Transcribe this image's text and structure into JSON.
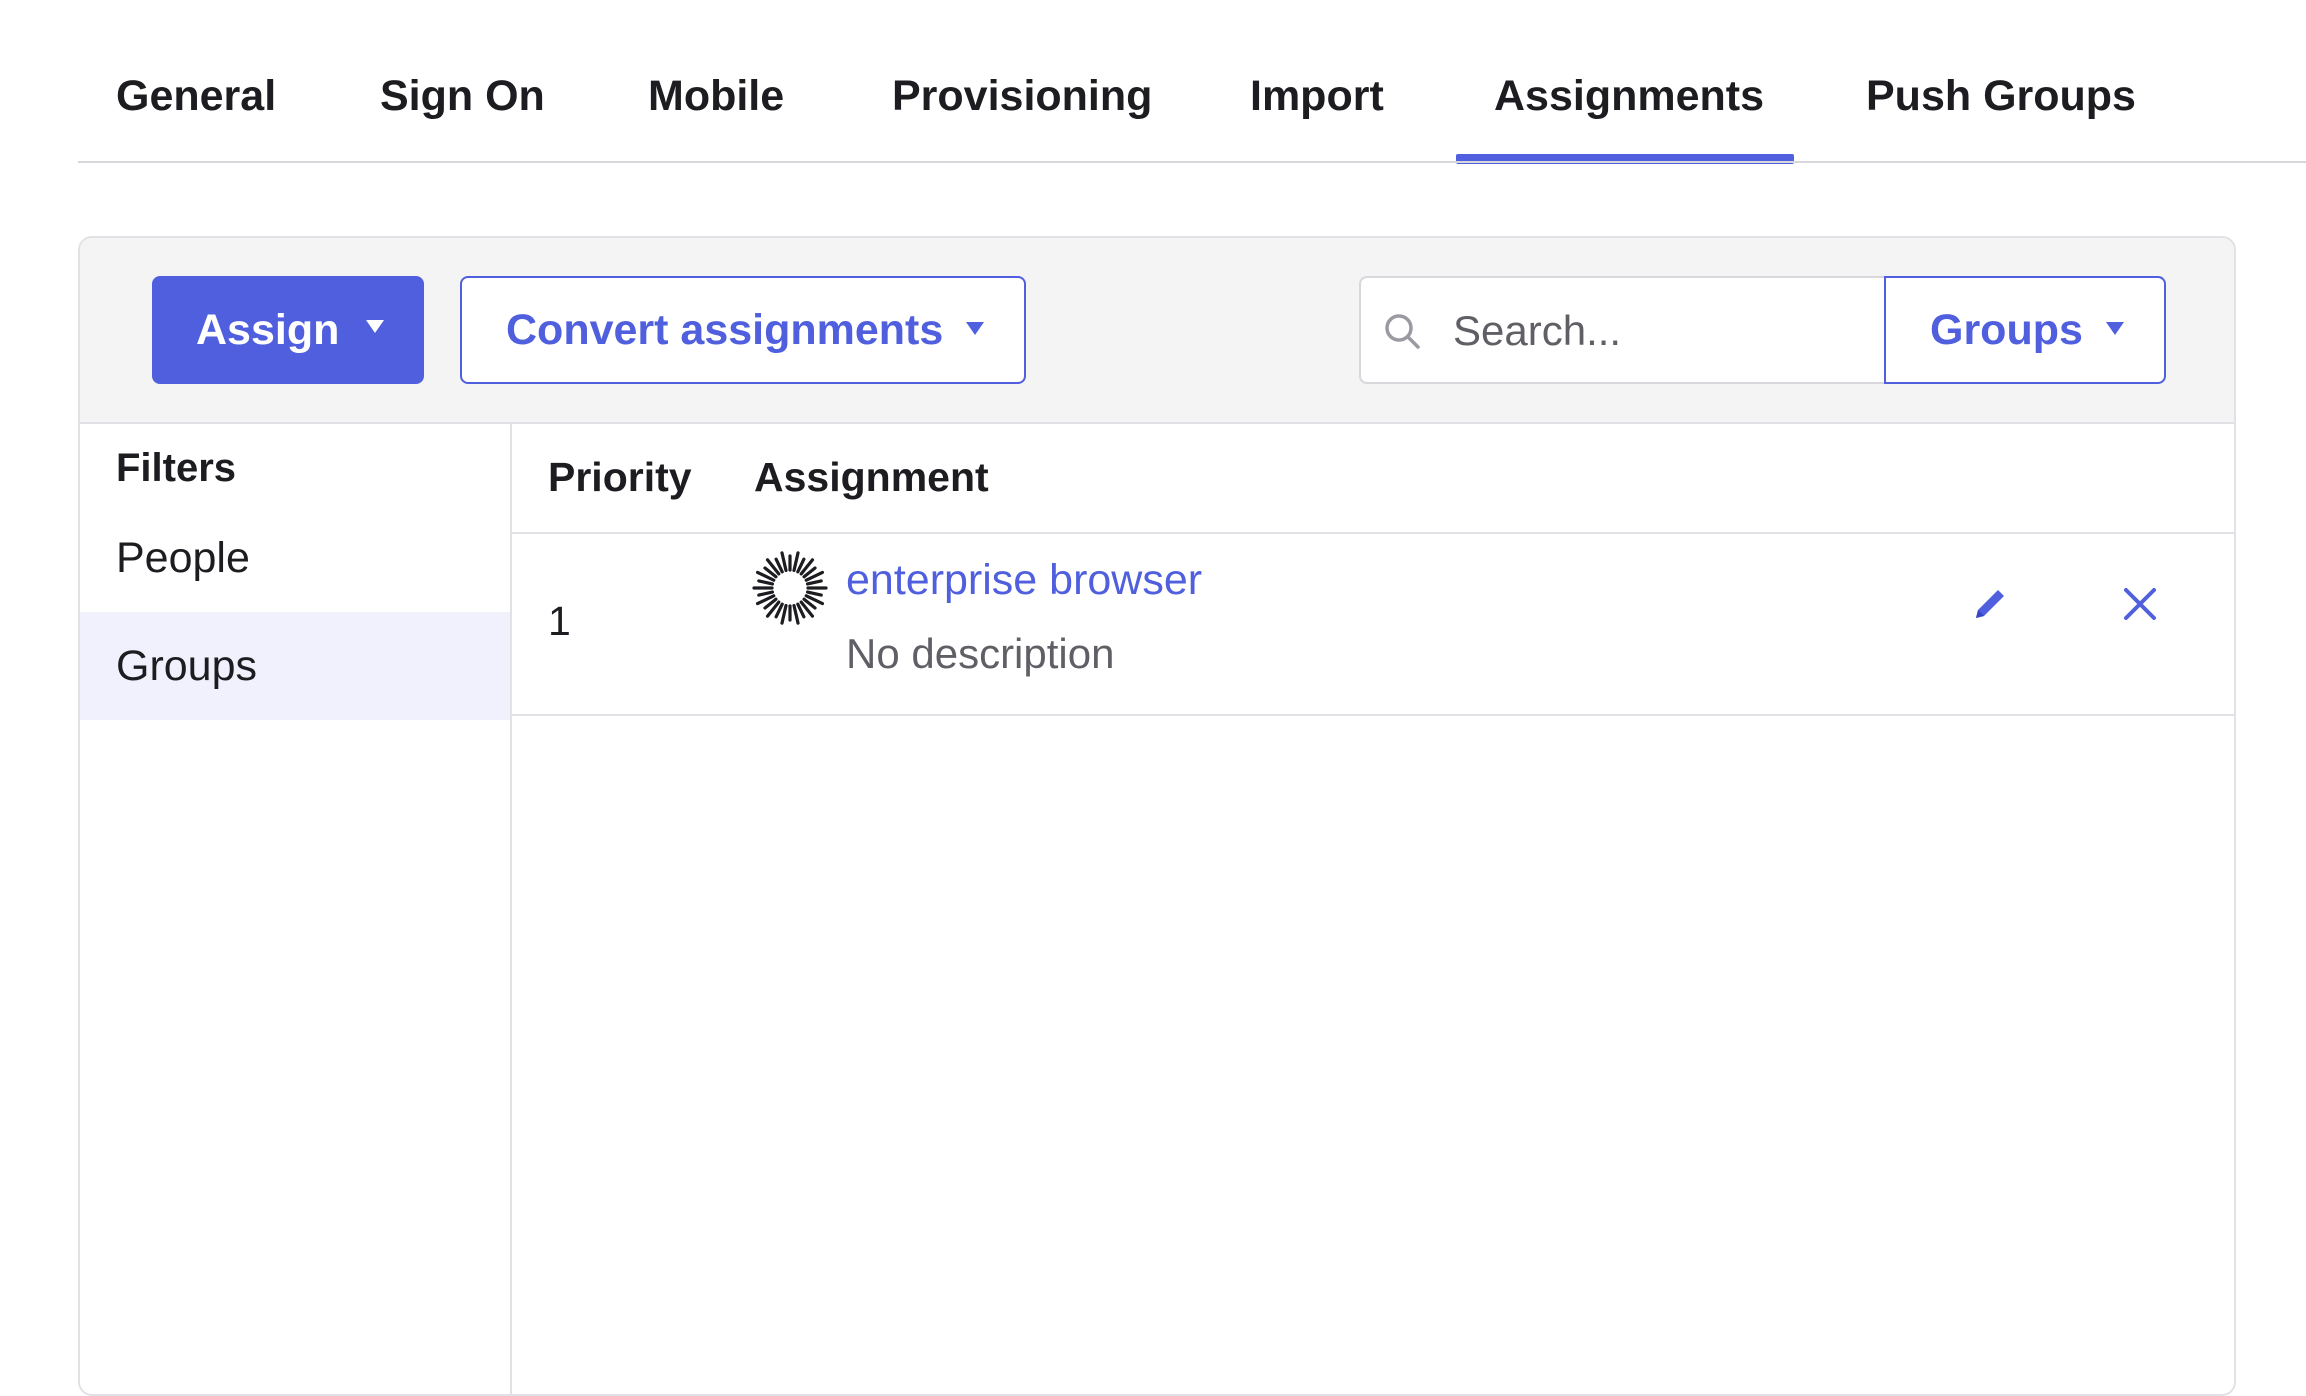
{
  "tabs": [
    {
      "label": "General"
    },
    {
      "label": "Sign On"
    },
    {
      "label": "Mobile"
    },
    {
      "label": "Provisioning"
    },
    {
      "label": "Import"
    },
    {
      "label": "Assignments",
      "active": true
    },
    {
      "label": "Push Groups"
    }
  ],
  "toolbar": {
    "assign_label": "Assign",
    "convert_label": "Convert assignments",
    "search_placeholder": "Search...",
    "search_value": "",
    "scope_label": "Groups"
  },
  "filters": {
    "title": "Filters",
    "items": [
      {
        "label": "People",
        "selected": false
      },
      {
        "label": "Groups",
        "selected": true
      }
    ]
  },
  "table": {
    "columns": [
      "Priority",
      "Assignment"
    ],
    "rows": [
      {
        "priority": "1",
        "name": "enterprise browser",
        "description": "No description",
        "icon": "group-sunburst-icon"
      }
    ]
  },
  "icons": {
    "search": "search-icon",
    "caret": "caret-down-icon",
    "edit": "pencil-icon",
    "remove": "close-icon"
  },
  "colors": {
    "accent": "#4f5fdd",
    "toolbar_bg": "#f4f4f5",
    "selected_filter_bg": "#f0f1fd",
    "border": "#e2e2e6",
    "text": "#1d1d21",
    "muted_text": "#5f5f66"
  }
}
